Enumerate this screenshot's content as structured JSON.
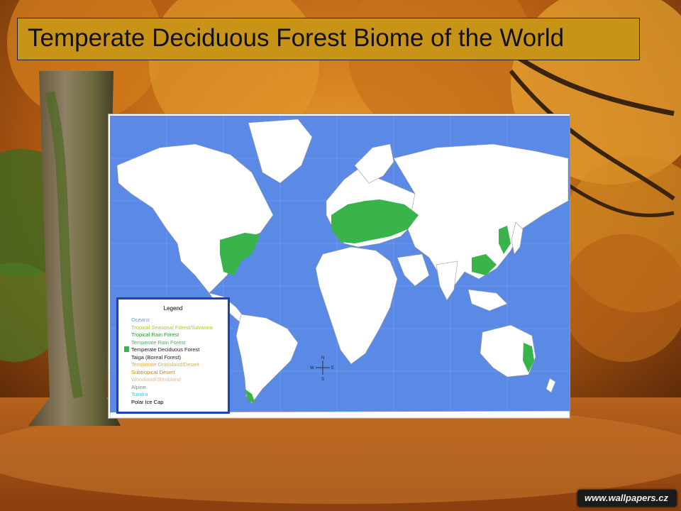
{
  "slide": {
    "title": "Temperate Deciduous Forest Biome of the World"
  },
  "map": {
    "ocean_color": "#5a8ae6",
    "land_color": "#ffffff",
    "highlight_color": "#39b44a",
    "compass": {
      "n": "N",
      "s": "S",
      "e": "E",
      "w": "W"
    },
    "legend": {
      "title": "Legend",
      "items": [
        {
          "label": "Oceans",
          "color": "#5aa0e6"
        },
        {
          "label": "Tropical Seasonal Forest/Savanna",
          "color": "#a8c832"
        },
        {
          "label": "Tropical Rain Forest",
          "color": "#1ea028"
        },
        {
          "label": "Temperate Rain Forest",
          "color": "#4cae64"
        },
        {
          "label": "Temperate Deciduous Forest",
          "color": "#222222",
          "swatch": "#39b44a"
        },
        {
          "label": "Taiga (Boreal Forest)",
          "color": "#222222"
        },
        {
          "label": "Temperate Grassland/Desert",
          "color": "#e0b020"
        },
        {
          "label": "Subtropical Desert",
          "color": "#c08a20"
        },
        {
          "label": "Woodland/Shrubland",
          "color": "#e8b890"
        },
        {
          "label": "Alpine",
          "color": "#888888"
        },
        {
          "label": "Tundra",
          "color": "#4cc0e0"
        },
        {
          "label": "Polar Ice Cap",
          "color": "#000000"
        }
      ]
    }
  },
  "watermark": {
    "text": "www.wallpapers.cz"
  }
}
